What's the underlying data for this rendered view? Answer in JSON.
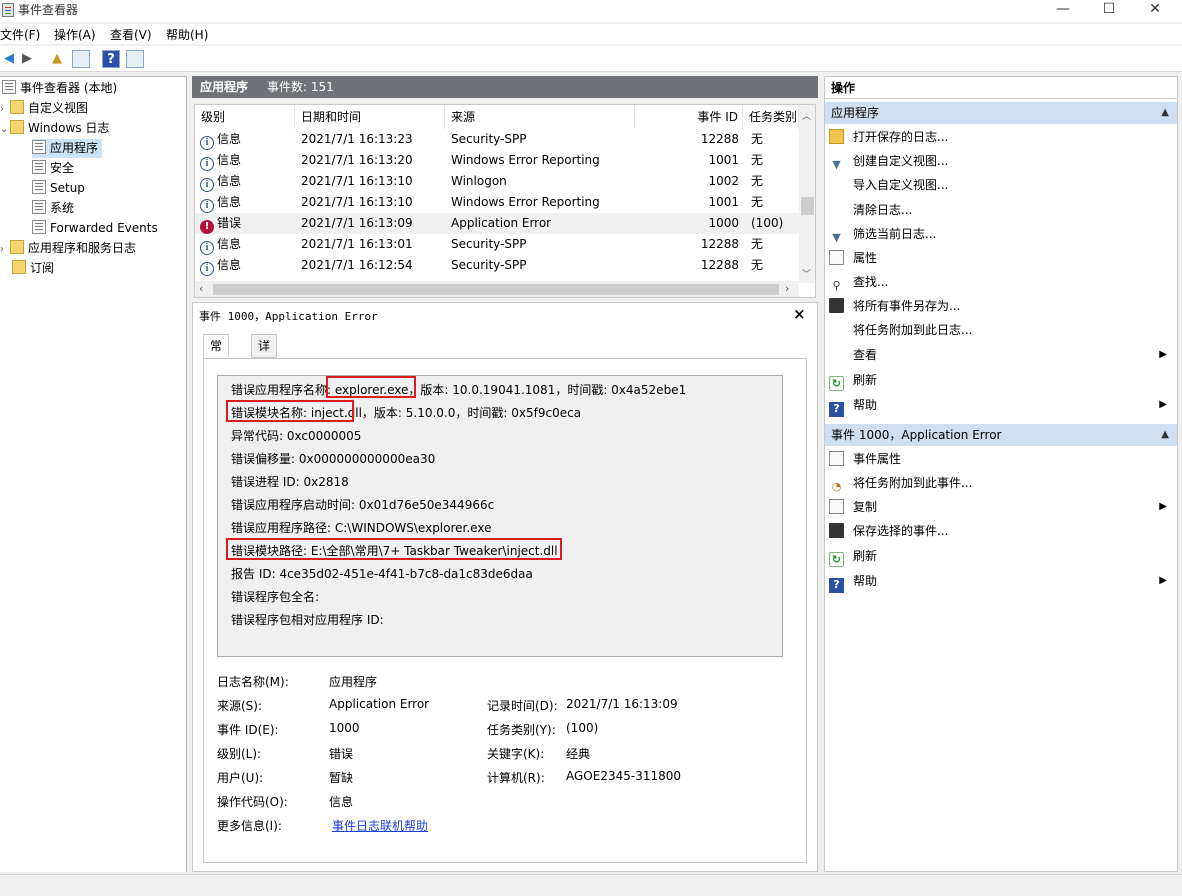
{
  "window": {
    "title": "事件查看器",
    "min": "—",
    "max": "☐",
    "close": "✕"
  },
  "menu": [
    "文件(F)",
    "操作(A)",
    "查看(V)",
    "帮助(H)"
  ],
  "tree": {
    "root": "事件查看器 (本地)",
    "custom_views": "自定义视图",
    "windows_logs": "Windows 日志",
    "items": [
      "应用程序",
      "安全",
      "Setup",
      "系统",
      "Forwarded Events"
    ],
    "app_service_logs": "应用程序和服务日志",
    "subscriptions": "订阅"
  },
  "list": {
    "log_name": "应用程序",
    "count_label": "事件数: 151",
    "columns": [
      "级别",
      "日期和时间",
      "来源",
      "事件 ID",
      "任务类别"
    ],
    "rows": [
      {
        "level": "信息",
        "datetime": "2021/7/1 16:13:23",
        "source": "Security-SPP",
        "id": "12288",
        "task": "无"
      },
      {
        "level": "信息",
        "datetime": "2021/7/1 16:13:20",
        "source": "Windows Error Reporting",
        "id": "1001",
        "task": "无"
      },
      {
        "level": "信息",
        "datetime": "2021/7/1 16:13:10",
        "source": "Winlogon",
        "id": "1002",
        "task": "无"
      },
      {
        "level": "信息",
        "datetime": "2021/7/1 16:13:10",
        "source": "Windows Error Reporting",
        "id": "1001",
        "task": "无"
      },
      {
        "level": "错误",
        "datetime": "2021/7/1 16:13:09",
        "source": "Application Error",
        "id": "1000",
        "task": "(100)"
      },
      {
        "level": "信息",
        "datetime": "2021/7/1 16:13:01",
        "source": "Security-SPP",
        "id": "12288",
        "task": "无"
      },
      {
        "level": "信息",
        "datetime": "2021/7/1 16:12:54",
        "source": "Security-SPP",
        "id": "12288",
        "task": "无"
      }
    ]
  },
  "detail": {
    "title": "事件 1000，Application Error",
    "close": "×",
    "tabs": [
      "常规",
      "详细信息"
    ],
    "description": [
      "错误应用程序名称: explorer.exe，版本: 10.0.19041.1081，时间戳: 0x4a52ebe1",
      "错误模块名称: inject.dll，版本: 5.10.0.0，时间戳: 0x5f9c0eca",
      "异常代码: 0xc0000005",
      "错误偏移量: 0x000000000000ea30",
      "错误进程 ID: 0x2818",
      "错误应用程序启动时间: 0x01d76e50e344966c",
      "错误应用程序路径: C:\\WINDOWS\\explorer.exe",
      "错误模块路径: E:\\全部\\常用\\7+ Taskbar Tweaker\\inject.dll",
      "报告 ID: 4ce35d02-451e-4f41-b7c8-da1c83de6daa",
      "错误程序包全名:",
      "错误程序包相对应用程序 ID:"
    ],
    "fields": {
      "log_name_label": "日志名称(M):",
      "log_name": "应用程序",
      "source_label": "来源(S):",
      "source": "Application Error",
      "logged_label": "记录时间(D):",
      "logged": "2021/7/1 16:13:09",
      "event_id_label": "事件 ID(E):",
      "event_id": "1000",
      "task_label": "任务类别(Y):",
      "task": "(100)",
      "level_label": "级别(L):",
      "level": "错误",
      "keywords_label": "关键字(K):",
      "keywords": "经典",
      "user_label": "用户(U):",
      "user": "暂缺",
      "computer_label": "计算机(R):",
      "computer": "AGOE2345-311800",
      "opcode_label": "操作代码(O):",
      "opcode": "信息",
      "more_label": "更多信息(I):",
      "more_link": "事件日志联机帮助"
    }
  },
  "actions": {
    "title": "操作",
    "section1": "应用程序",
    "items1": [
      "打开保存的日志...",
      "创建自定义视图...",
      "导入自定义视图...",
      "清除日志...",
      "筛选当前日志...",
      "属性",
      "查找...",
      "将所有事件另存为...",
      "将任务附加到此日志...",
      "查看",
      "刷新",
      "帮助"
    ],
    "section2": "事件 1000，Application Error",
    "items2": [
      "事件属性",
      "将任务附加到此事件...",
      "复制",
      "保存选择的事件...",
      "刷新",
      "帮助"
    ]
  },
  "colors": {
    "highlight_border": "#d81e1e",
    "header_bg": "#6f7276",
    "section_bg": "#cfdff2",
    "link": "#1c3fd6",
    "error_icon": "#b0113d"
  }
}
